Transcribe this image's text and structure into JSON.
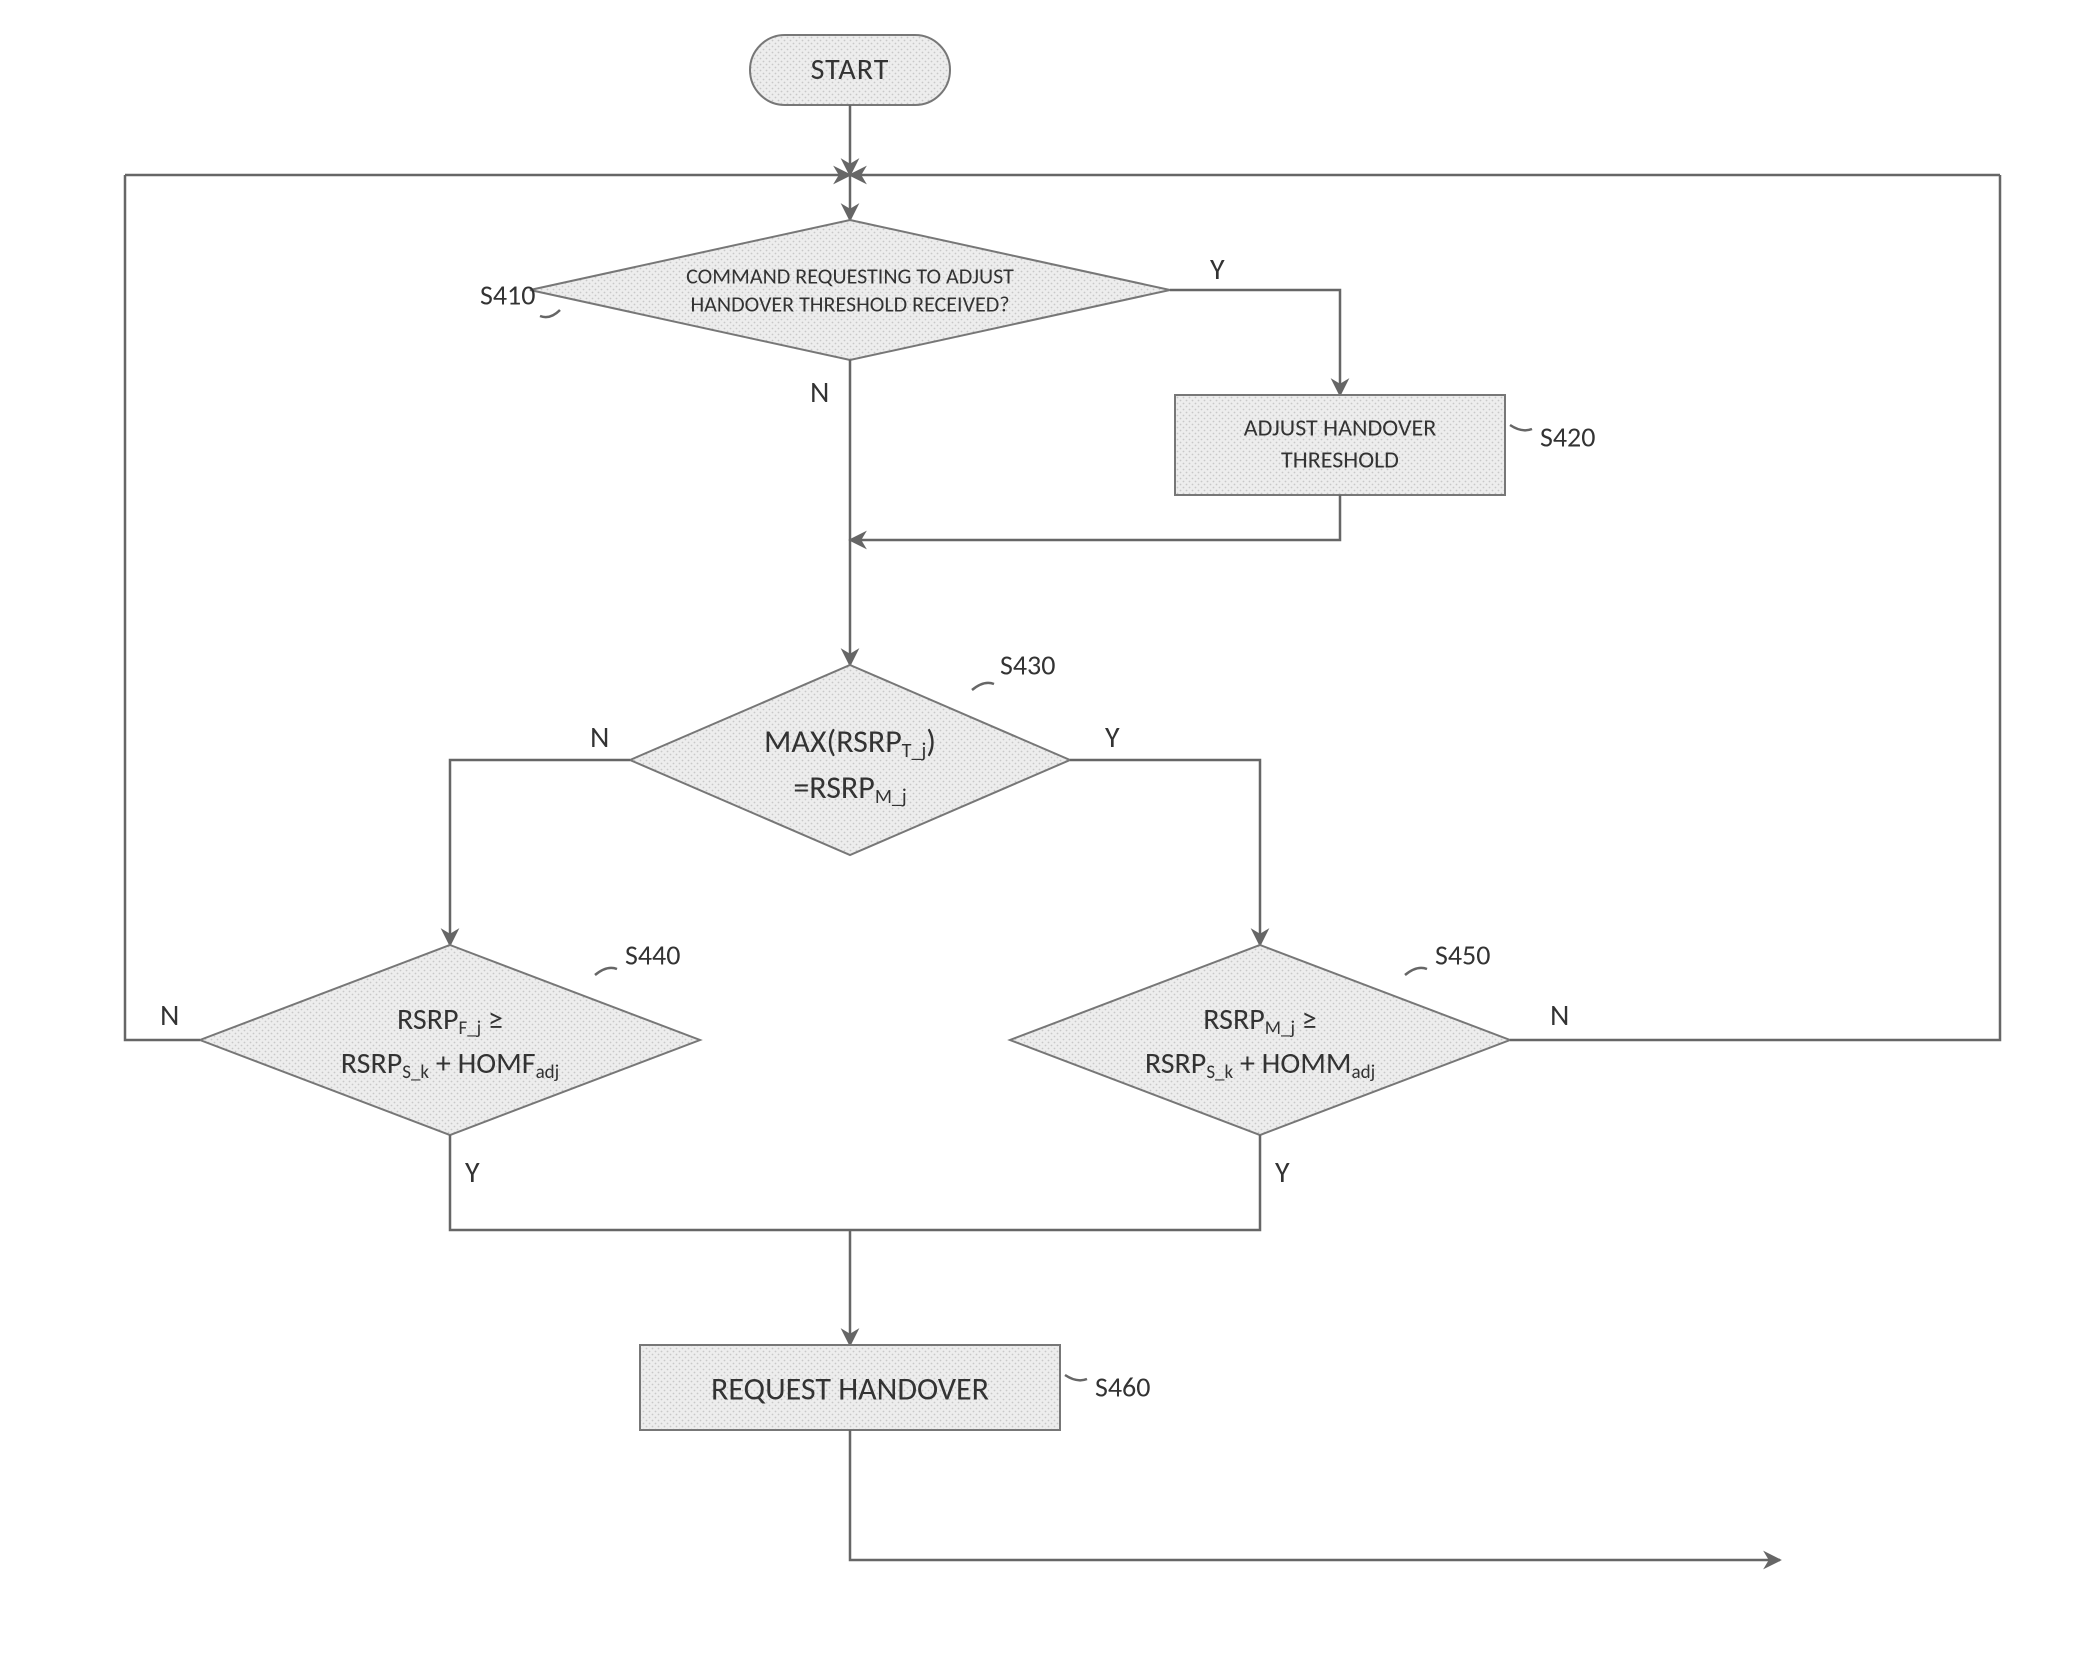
{
  "nodes": {
    "start": {
      "label": "START",
      "step": ""
    },
    "s410": {
      "line1": "COMMAND REQUESTING TO ADJUST",
      "line2": "HANDOVER THRESHOLD RECEIVED?",
      "step": "S410"
    },
    "s420": {
      "line1": "ADJUST HANDOVER",
      "line2": "THRESHOLD",
      "step": "S420"
    },
    "s430": {
      "line1_a": "MAX(RSRP",
      "line1_sub": "T_j",
      "line1_b": ")",
      "line2_a": "=RSRP",
      "line2_sub": "M_j",
      "step": "S430"
    },
    "s440": {
      "line1_a": "RSRP",
      "line1_sub": "F_j",
      "line1_b": " ≥",
      "line2_a": "RSRP",
      "line2_sub1": "S_k",
      "line2_b": " + HOMF",
      "line2_sub2": "adj",
      "step": "S440"
    },
    "s450": {
      "line1_a": "RSRP",
      "line1_sub": "M_j",
      "line1_b": " ≥",
      "line2_a": "RSRP",
      "line2_sub1": "S_k",
      "line2_b": " + HOMM",
      "line2_sub2": "adj",
      "step": "S450"
    },
    "s460": {
      "label": "REQUEST HANDOVER",
      "step": "S460"
    }
  },
  "edgeLabels": {
    "Y": "Y",
    "N": "N"
  }
}
